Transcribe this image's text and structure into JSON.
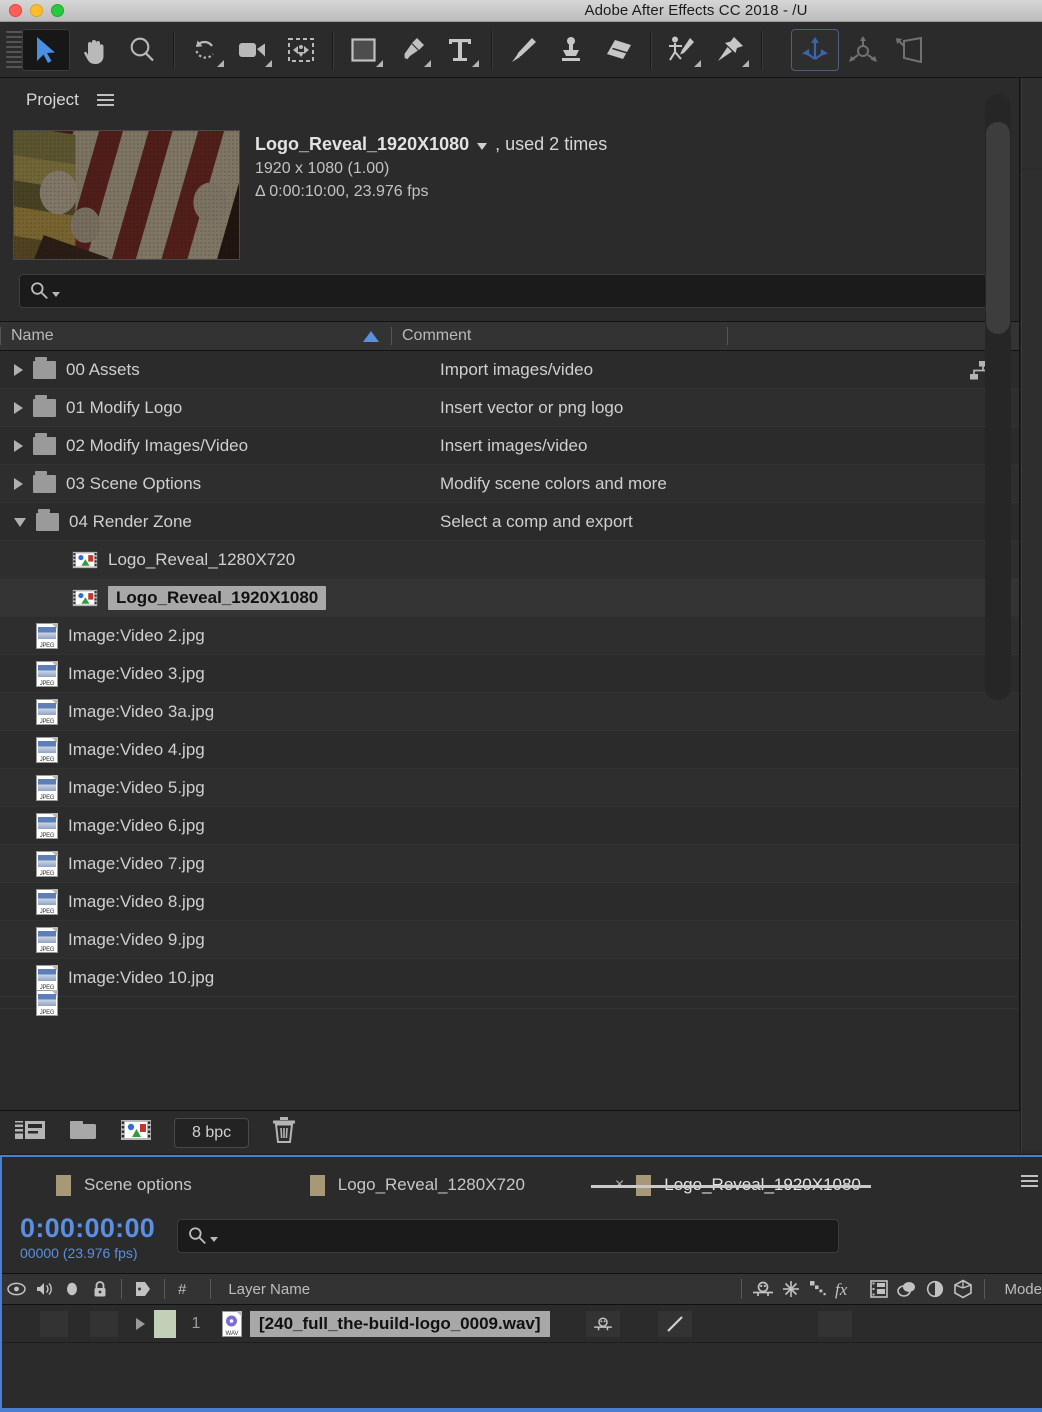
{
  "window": {
    "title": "Adobe After Effects CC 2018 - /U",
    "controls": [
      "close",
      "minimize",
      "maximize"
    ]
  },
  "toolbar": {
    "tools": [
      {
        "name": "selection-tool",
        "icon": "arrow-cursor",
        "active": true
      },
      {
        "name": "hand-tool",
        "icon": "hand"
      },
      {
        "name": "zoom-tool",
        "icon": "magnifier"
      },
      {
        "name": "rotation-tool",
        "icon": "rotate"
      },
      {
        "name": "camera-tool",
        "icon": "camera"
      },
      {
        "name": "pan-behind-tool",
        "icon": "anchor-point"
      },
      {
        "name": "shape-tool",
        "icon": "rectangle"
      },
      {
        "name": "pen-tool",
        "icon": "pen"
      },
      {
        "name": "type-tool",
        "icon": "text-t"
      },
      {
        "name": "brush-tool",
        "icon": "paintbrush"
      },
      {
        "name": "clone-stamp-tool",
        "icon": "clone-stamp"
      },
      {
        "name": "eraser-tool",
        "icon": "eraser"
      },
      {
        "name": "roto-brush-tool",
        "icon": "roto-brush"
      },
      {
        "name": "puppet-pin-tool",
        "icon": "pushpin"
      },
      {
        "name": "unified-camera-tool",
        "icon": "axis-3d",
        "selected3d": true
      },
      {
        "name": "orbit-tool",
        "icon": "orbit-3d"
      },
      {
        "name": "track-camera-tool",
        "icon": "camera-3d"
      }
    ]
  },
  "project": {
    "panel_title": "Project",
    "selected_item": {
      "name": "Logo_Reveal_1920X1080",
      "usage": ", used 2 times",
      "dimensions": "1920 x 1080 (1.00)",
      "duration": "Δ 0:00:10:00, 23.976 fps"
    },
    "search": {
      "placeholder": "",
      "value": ""
    },
    "columns": {
      "name": "Name",
      "comment": "Comment"
    },
    "items": [
      {
        "type": "folder",
        "expanded": false,
        "name": "00 Assets",
        "comment": "Import images/video",
        "indent": 0
      },
      {
        "type": "folder",
        "expanded": false,
        "name": "01 Modify Logo",
        "comment": "Insert vector or png logo",
        "indent": 0
      },
      {
        "type": "folder",
        "expanded": false,
        "name": "02 Modify Images/Video",
        "comment": "Insert images/video",
        "indent": 0
      },
      {
        "type": "folder",
        "expanded": false,
        "name": "03 Scene Options",
        "comment": "Modify scene colors and more",
        "indent": 0
      },
      {
        "type": "folder",
        "expanded": true,
        "name": "04 Render Zone",
        "comment": "Select a comp and export",
        "indent": 0
      },
      {
        "type": "comp",
        "name": "Logo_Reveal_1280X720",
        "comment": "",
        "indent": 2,
        "selected": false
      },
      {
        "type": "comp",
        "name": "Logo_Reveal_1920X1080",
        "comment": "",
        "indent": 2,
        "selected": true
      },
      {
        "type": "jpeg",
        "name": "Image:Video 2.jpg",
        "comment": "",
        "indent": 1
      },
      {
        "type": "jpeg",
        "name": "Image:Video 3.jpg",
        "comment": "",
        "indent": 1
      },
      {
        "type": "jpeg",
        "name": "Image:Video 3a.jpg",
        "comment": "",
        "indent": 1
      },
      {
        "type": "jpeg",
        "name": "Image:Video 4.jpg",
        "comment": "",
        "indent": 1
      },
      {
        "type": "jpeg",
        "name": "Image:Video 5.jpg",
        "comment": "",
        "indent": 1
      },
      {
        "type": "jpeg",
        "name": "Image:Video 6.jpg",
        "comment": "",
        "indent": 1
      },
      {
        "type": "jpeg",
        "name": "Image:Video 7.jpg",
        "comment": "",
        "indent": 1
      },
      {
        "type": "jpeg",
        "name": "Image:Video 8.jpg",
        "comment": "",
        "indent": 1
      },
      {
        "type": "jpeg",
        "name": "Image:Video 9.jpg",
        "comment": "",
        "indent": 1
      },
      {
        "type": "jpeg",
        "name": "Image:Video 10.jpg",
        "comment": "",
        "indent": 1
      }
    ],
    "footer": {
      "bit_depth": "8 bpc",
      "buttons": [
        "new-comp-icon",
        "new-folder-icon",
        "comp-icon",
        "delete-icon"
      ]
    }
  },
  "timeline": {
    "tabs": [
      {
        "label": "Scene options",
        "active": false,
        "closable": false
      },
      {
        "label": "Logo_Reveal_1280X720",
        "active": false,
        "closable": false
      },
      {
        "label": "Logo_Reveal_1920X1080",
        "active": true,
        "closable": true,
        "close_glyph": "×"
      }
    ],
    "current_time": "0:00:00:00",
    "frame_info": "00000 (23.976 fps)",
    "search": {
      "placeholder": "",
      "value": ""
    },
    "columns": {
      "hash": "#",
      "layer_name": "Layer Name",
      "mode": "Mode",
      "switch_icons": [
        "parent-icon",
        "sun-icon",
        "motion-blur-icon",
        "fx-icon",
        "frame-blend-icon",
        "shy-icon",
        "adjustment-icon",
        "3d-layer-icon"
      ],
      "av_icons": [
        "eye-icon",
        "speaker-icon",
        "solo-icon",
        "lock-icon",
        "label-icon"
      ]
    },
    "layers": [
      {
        "number": "1",
        "name": "[240_full_the-build-logo_0009.wav]",
        "color": "#c2d0b8",
        "icon": "wav-file-icon"
      }
    ]
  },
  "colors": {
    "accent_blue": "#5b8fe0",
    "panel_bg": "#2b2b2b",
    "header_bg": "#333333",
    "selection": "#a8a8a8",
    "tab_square": "#a79878",
    "layer_chip": "#c2d0b8"
  }
}
